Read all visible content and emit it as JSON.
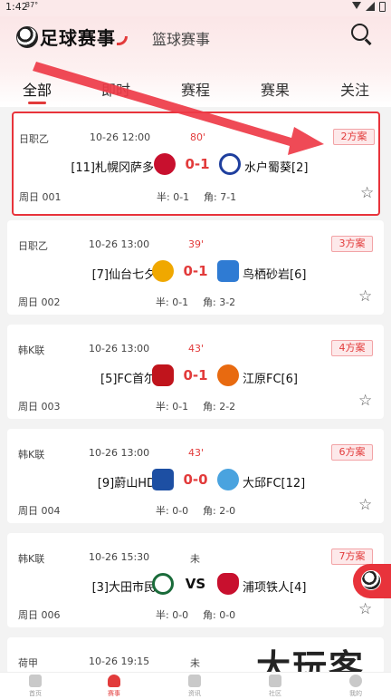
{
  "status_bar": {
    "time": "1:42",
    "temp": "37°"
  },
  "header": {
    "sport_tabs": {
      "football": "足球赛事",
      "basketball": "篮球赛事"
    },
    "subtabs": [
      "全部",
      "即时",
      "赛程",
      "赛果",
      "关注"
    ],
    "active_subtab": "全部"
  },
  "matches": [
    {
      "league": "日职乙",
      "time": "10-26 12:00",
      "minute": "80'",
      "plans": "2方案",
      "home": "[11]札幌冈萨多",
      "away": "水户蜀葵[2]",
      "score": "0-1",
      "round": "周日 001",
      "half": "半: 0-1",
      "corner": "角: 7-1",
      "home_color": "#c8102e",
      "away_color": "#1f3f9e",
      "highlighted": true
    },
    {
      "league": "日职乙",
      "time": "10-26 13:00",
      "minute": "39'",
      "plans": "3方案",
      "home": "[7]仙台七夕",
      "away": "鸟栖砂岩[6]",
      "score": "0-1",
      "round": "周日 002",
      "half": "半: 0-1",
      "corner": "角: 3-2",
      "home_color": "#f0a800",
      "away_color": "#2f7bd3",
      "highlighted": false
    },
    {
      "league": "韩K联",
      "time": "10-26 13:00",
      "minute": "43'",
      "plans": "4方案",
      "home": "[5]FC首尔",
      "away": "江原FC[6]",
      "score": "0-1",
      "round": "周日 003",
      "half": "半: 0-1",
      "corner": "角: 2-2",
      "home_color": "#c0141c",
      "away_color": "#e86a10",
      "highlighted": false
    },
    {
      "league": "韩K联",
      "time": "10-26 13:00",
      "minute": "43'",
      "plans": "6方案",
      "home": "[9]蔚山HD",
      "away": "大邱FC[12]",
      "score": "0-0",
      "round": "周日 004",
      "half": "半: 0-0",
      "corner": "角: 2-0",
      "home_color": "#1d4fa3",
      "away_color": "#4aa3df",
      "highlighted": false
    },
    {
      "league": "韩K联",
      "time": "10-26 15:30",
      "minute": "未",
      "plans": "7方案",
      "home": "[3]大田市民",
      "away": "浦项铁人[4]",
      "score": "VS",
      "round": "周日 006",
      "half": "半: 0-0",
      "corner": "角: 0-0",
      "home_color": "#1a6b3a",
      "away_color": "#c8102e",
      "highlighted": false
    },
    {
      "league": "荷甲",
      "time": "10-26 19:15",
      "minute": "未"
    }
  ],
  "bottom_nav": [
    "首页",
    "赛事",
    "资讯",
    "社区",
    "我的"
  ],
  "active_nav": "赛事",
  "watermark": "大玩客"
}
